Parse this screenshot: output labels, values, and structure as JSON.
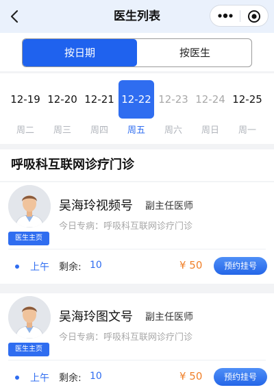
{
  "nav": {
    "title": "医生列表",
    "back_icon": "chevron-left-icon",
    "more_icon": "more-dots-icon",
    "close_icon": "target-close-icon"
  },
  "toggle": {
    "by_date": "按日期",
    "by_doctor": "按医生",
    "active": "by_date"
  },
  "dates": [
    {
      "date": "12-19",
      "weekday": "周二",
      "state": "normal"
    },
    {
      "date": "12-20",
      "weekday": "周三",
      "state": "normal"
    },
    {
      "date": "12-21",
      "weekday": "周四",
      "state": "normal"
    },
    {
      "date": "12-22",
      "weekday": "周五",
      "state": "selected"
    },
    {
      "date": "12-23",
      "weekday": "周六",
      "state": "disabled"
    },
    {
      "date": "12-24",
      "weekday": "周日",
      "state": "disabled"
    },
    {
      "date": "12-25",
      "weekday": "周一",
      "state": "normal"
    }
  ],
  "section": {
    "title": "呼吸科互联网诊疗门诊"
  },
  "doctors": [
    {
      "name": "吴海玲视频号",
      "title": "副主任医师",
      "specialty": "今日专病：呼吸科互联网诊疗门诊",
      "home_badge": "医生主页",
      "slot": {
        "time": "上午",
        "remain_label": "剩余:",
        "remain_value": "10",
        "price": "¥ 50",
        "book": "预约挂号"
      }
    },
    {
      "name": "吴海玲图文号",
      "title": "副主任医师",
      "specialty": "今日专病：呼吸科互联网诊疗门诊",
      "home_badge": "医生主页",
      "slot": {
        "time": "上午",
        "remain_label": "剩余:",
        "remain_value": "10",
        "price": "¥ 50",
        "book": "预约挂号"
      }
    }
  ],
  "colors": {
    "accent": "#2f6df0",
    "price": "#f0802a",
    "nav_bg": "#eaf1fc"
  }
}
